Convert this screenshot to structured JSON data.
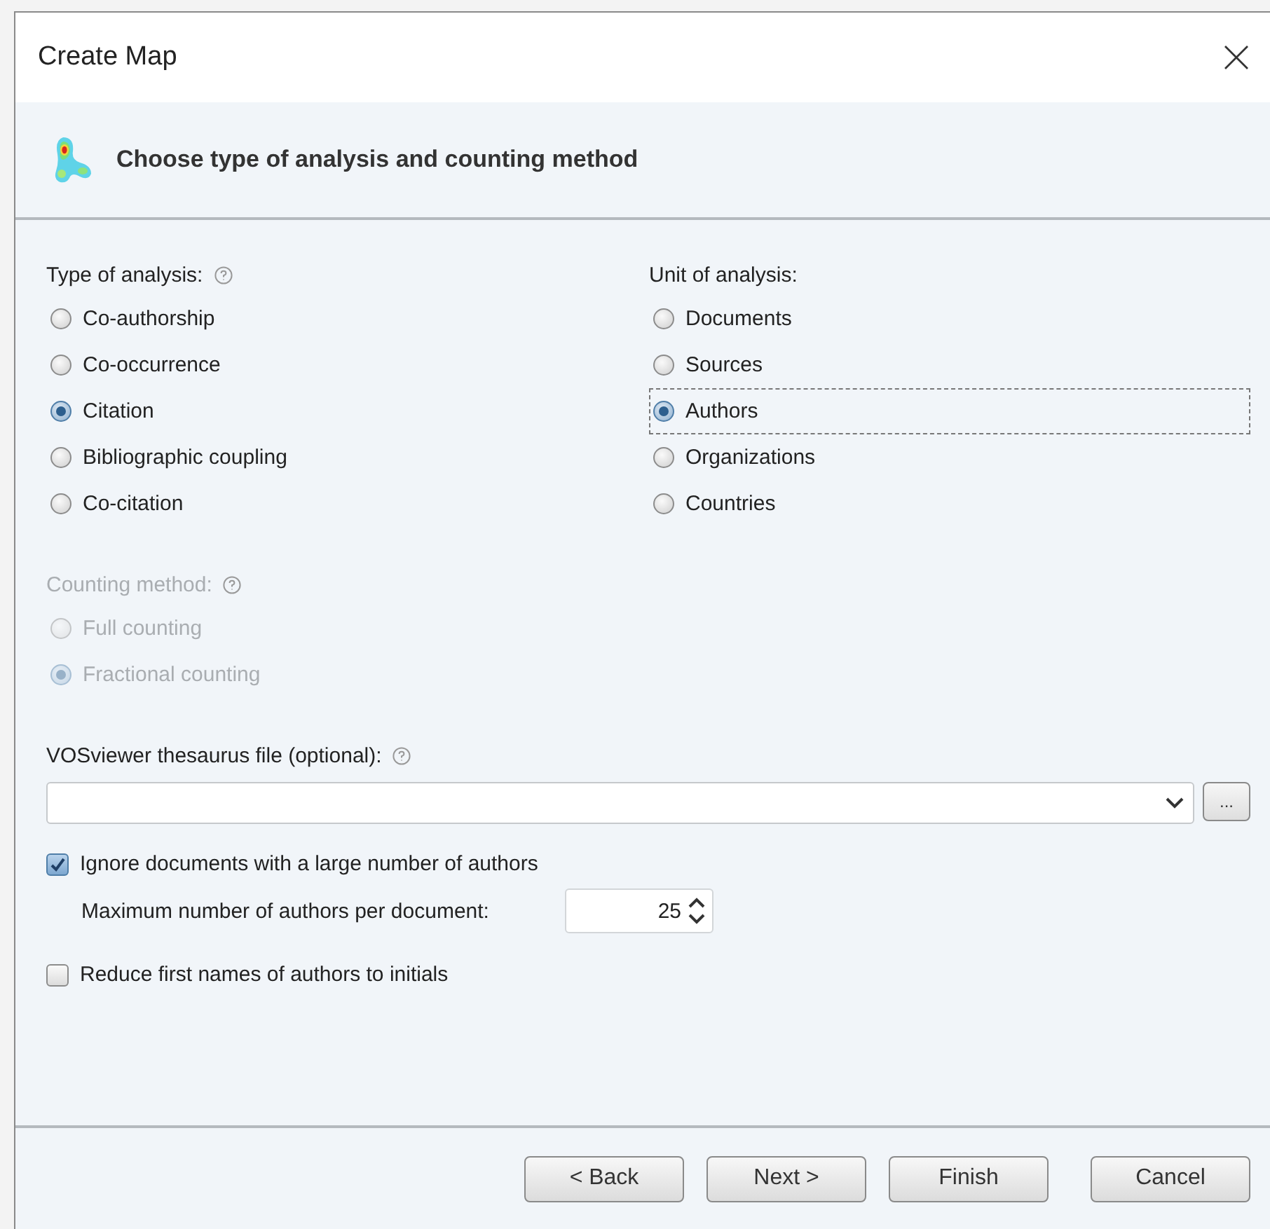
{
  "window": {
    "title": "Create Map"
  },
  "header": {
    "title": "Choose type of analysis and counting method"
  },
  "type_of_analysis": {
    "label": "Type of analysis:",
    "help": true,
    "options": [
      {
        "label": "Co-authorship",
        "selected": false
      },
      {
        "label": "Co-occurrence",
        "selected": false
      },
      {
        "label": "Citation",
        "selected": true
      },
      {
        "label": "Bibliographic coupling",
        "selected": false
      },
      {
        "label": "Co-citation",
        "selected": false
      }
    ]
  },
  "unit_of_analysis": {
    "label": "Unit of analysis:",
    "options": [
      {
        "label": "Documents",
        "selected": false,
        "focused": false
      },
      {
        "label": "Sources",
        "selected": false,
        "focused": false
      },
      {
        "label": "Authors",
        "selected": true,
        "focused": true
      },
      {
        "label": "Organizations",
        "selected": false,
        "focused": false
      },
      {
        "label": "Countries",
        "selected": false,
        "focused": false
      }
    ]
  },
  "counting_method": {
    "label": "Counting method:",
    "help": true,
    "disabled": true,
    "options": [
      {
        "label": "Full counting",
        "selected": false
      },
      {
        "label": "Fractional counting",
        "selected": true
      }
    ]
  },
  "thesaurus": {
    "label": "VOSviewer thesaurus file (optional):",
    "browse": "..."
  },
  "ignore_documents": {
    "label": "Ignore documents with a large number of authors",
    "checked": true
  },
  "max_authors": {
    "label": "Maximum number of authors per document:",
    "value": "25"
  },
  "reduce_names": {
    "label": "Reduce first names of authors to initials",
    "checked": false
  },
  "buttons": [
    "< Back",
    "Next >",
    "Finish",
    "Cancel"
  ]
}
